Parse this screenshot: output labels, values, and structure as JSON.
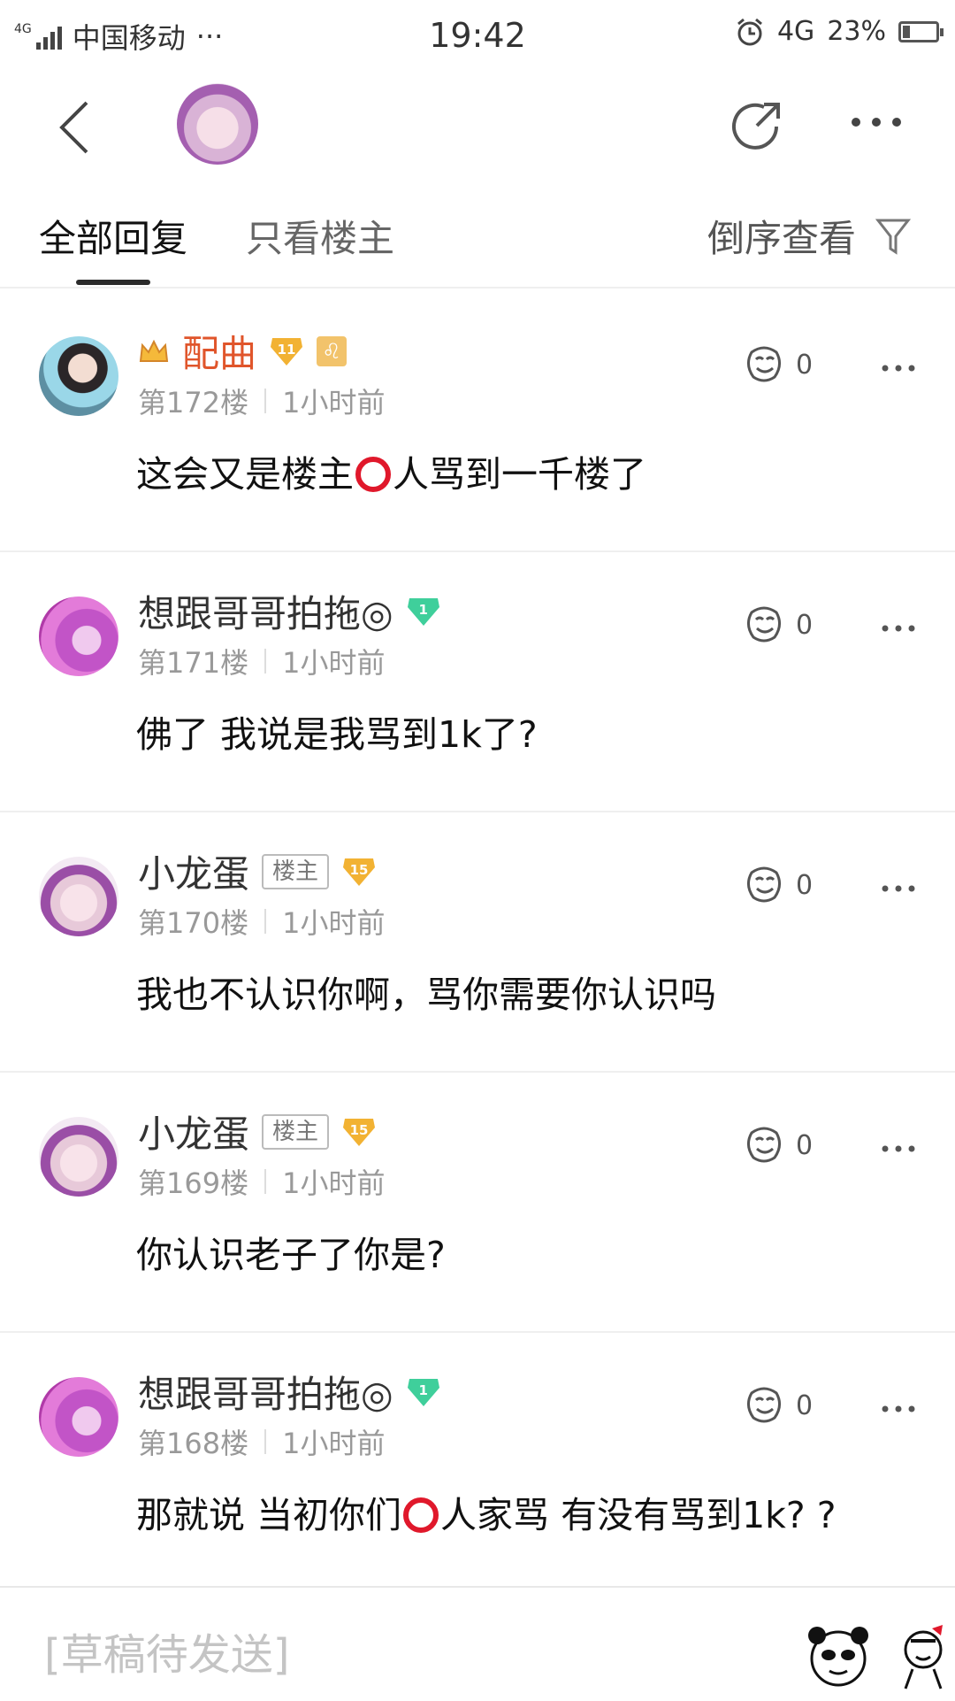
{
  "status_bar": {
    "network_type": "4G",
    "carrier": "中国移动",
    "dots": "···",
    "time": "19:42",
    "mobile_data": "4G",
    "battery_percent": "23%",
    "battery_level": 0.23
  },
  "header": {
    "back_icon": "chevron-left",
    "share_icon": "share-arrow",
    "more_icon": "ellipsis"
  },
  "tabs": {
    "all_replies": "全部回复",
    "op_only": "只看楼主",
    "sort_reverse": "倒序查看"
  },
  "posts": [
    {
      "username": "配曲",
      "level": "11",
      "floor": "第172楼",
      "time": "1小时前",
      "content_before": "这会又是楼主",
      "content_after": "人骂到一千楼了",
      "likes": "0"
    },
    {
      "username": "想跟哥哥拍拖◎",
      "level": "1",
      "floor": "第171楼",
      "time": "1小时前",
      "content": "佛了 我说是我骂到1k了?",
      "likes": "0"
    },
    {
      "username": "小龙蛋",
      "op_tag": "楼主",
      "level": "15",
      "floor": "第170楼",
      "time": "1小时前",
      "content": "我也不认识你啊，骂你需要你认识吗",
      "likes": "0"
    },
    {
      "username": "小龙蛋",
      "op_tag": "楼主",
      "level": "15",
      "floor": "第169楼",
      "time": "1小时前",
      "content": "你认识老子了你是?",
      "likes": "0"
    },
    {
      "username": "想跟哥哥拍拖◎",
      "level": "1",
      "floor": "第168楼",
      "time": "1小时前",
      "content_before": "那就说 当初你们",
      "content_after": "人家骂 有没有骂到1k? ?",
      "likes": "0"
    }
  ],
  "input_bar": {
    "draft_text": "[草稿待发送]"
  },
  "colors": {
    "accent_orange": "#e0552b",
    "badge_gold": "#f2b233",
    "badge_green": "#3fcf9b",
    "emoji_circle_red": "#e0182b"
  }
}
